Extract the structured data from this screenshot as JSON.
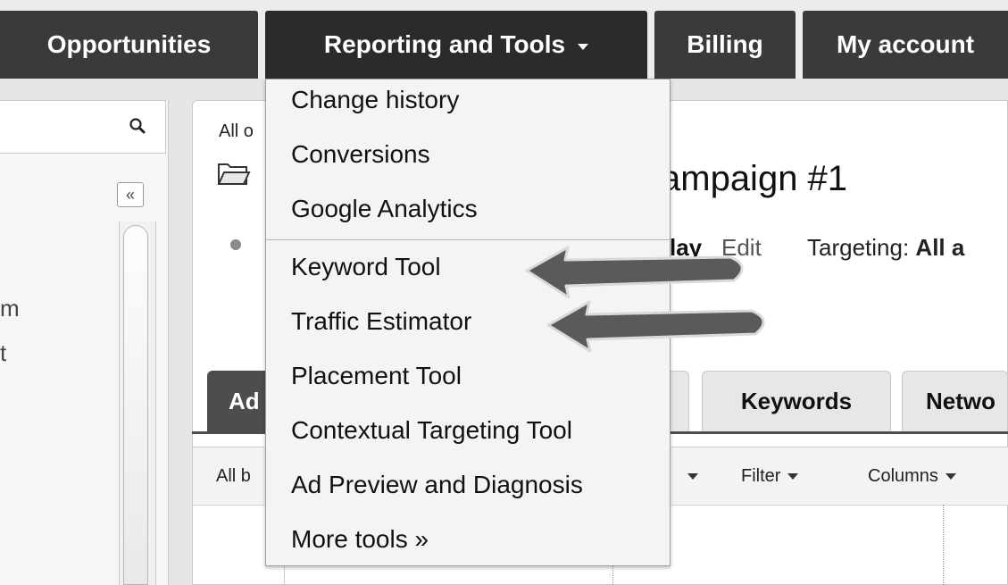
{
  "nav": {
    "tabs": [
      {
        "label": "Opportunities"
      },
      {
        "label": "Reporting and Tools"
      },
      {
        "label": "Billing"
      },
      {
        "label": "My account"
      }
    ]
  },
  "dropdown": {
    "items": [
      {
        "label": "Change history"
      },
      {
        "label": "Conversions"
      },
      {
        "label": "Google Analytics"
      },
      {
        "label": "Keyword Tool"
      },
      {
        "label": "Traffic Estimator"
      },
      {
        "label": "Placement Tool"
      },
      {
        "label": "Contextual Targeting Tool"
      },
      {
        "label": "Ad Preview and Diagnosis"
      },
      {
        "label": "More tools »"
      }
    ]
  },
  "sidebar": {
    "collapse_label": "«",
    "fragments": [
      "m",
      "t"
    ]
  },
  "main": {
    "breadcrumb": "All o",
    "campaign_title": "ampaign #1",
    "status_fragment": "lay",
    "edit_label": "Edit",
    "targeting_label": "Targeting:",
    "targeting_value": "All a",
    "subtabs": {
      "ads": "Ad",
      "keywords": "Keywords",
      "networks": "Netwo"
    },
    "toolbar": {
      "all_label": "All b",
      "filter_label": "Filter",
      "columns_label": "Columns"
    }
  },
  "colors": {
    "nav_tab_bg": "#3a3a3a",
    "arrow_fill": "#5a5a5a"
  }
}
